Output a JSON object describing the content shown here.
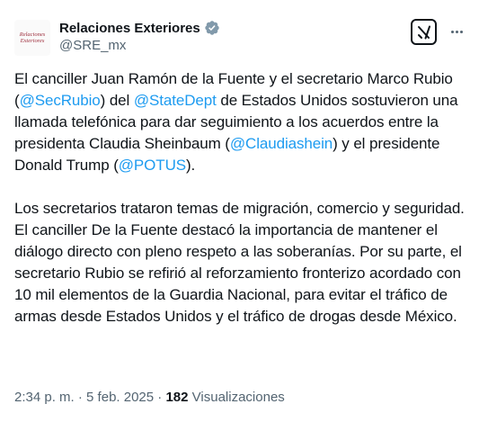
{
  "author": {
    "display_name": "Relaciones Exteriores",
    "handle": "@SRE_mx",
    "avatar_text_line1": "Relaciones",
    "avatar_text_line2": "Exteriores",
    "verified_color": "#829aab"
  },
  "actions": {
    "grok_icon": "grok-icon",
    "more_icon": "more-icon"
  },
  "tweet": {
    "p1": {
      "t1": "El canciller Juan Ramón de la Fuente y el secretario Marco Rubio (",
      "m1": "@SecRubio",
      "t2": ") del ",
      "m2": "@StateDept",
      "t3": " de Estados Unidos sostuvieron una llamada telefónica para dar seguimiento a los acuerdos entre la presidenta Claudia Sheinbaum (",
      "m3": "@Claudiashein",
      "t4": ") y el presidente Donald Trump (",
      "m4": "@POTUS",
      "t5": ")."
    },
    "p2": "Los secretarios trataron temas de migración, comercio y seguridad. El canciller De la Fuente destacó la importancia de mantener el diálogo directo con pleno respeto a las soberanías. Por su parte, el secretario Rubio se refirió al reforzamiento fronterizo acordado con 10 mil elementos de la Guardia Nacional, para evitar el tráfico de armas desde Estados Unidos y el tráfico de drogas desde México."
  },
  "meta": {
    "time": "2:34 p. m.",
    "sep1": " · ",
    "date": "5 feb. 2025",
    "sep2": " · ",
    "views_count": "182",
    "views_label": " Visualizaciones"
  },
  "colors": {
    "link": "#1d9bf0",
    "text": "#0f1419",
    "secondary": "#536471"
  }
}
